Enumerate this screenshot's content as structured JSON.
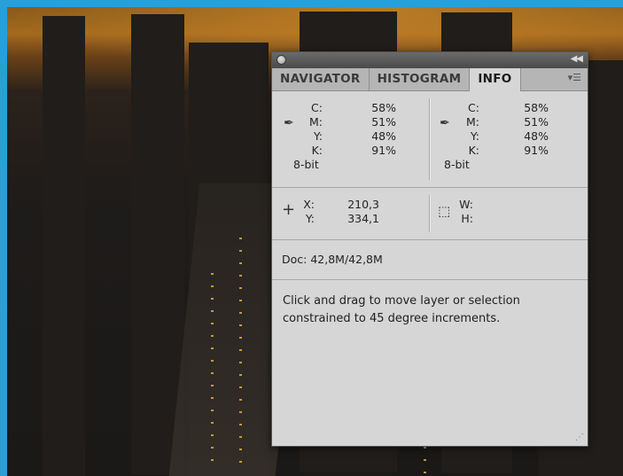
{
  "panel": {
    "tabs": [
      {
        "label": "NAVIGATOR"
      },
      {
        "label": "HISTOGRAM"
      },
      {
        "label": "INFO"
      }
    ],
    "left_color": {
      "labels": [
        "C:",
        "M:",
        "Y:",
        "K:"
      ],
      "values": [
        "58%",
        "51%",
        "48%",
        "91%"
      ],
      "bit": "8-bit"
    },
    "right_color": {
      "labels": [
        "C:",
        "M:",
        "Y:",
        "K:"
      ],
      "values": [
        "58%",
        "51%",
        "48%",
        "91%"
      ],
      "bit": "8-bit"
    },
    "position": {
      "x_label": "X:",
      "x_value": "210,3",
      "y_label": "Y:",
      "y_value": "334,1"
    },
    "size": {
      "w_label": "W:",
      "h_label": "H:"
    },
    "doc": "Doc: 42,8M/42,8M",
    "message": "Click and drag to move layer or selection constrained to 45 degree increments."
  },
  "icons": {
    "eyedropper": "eyedropper-icon",
    "crosshair": "crosshair-icon",
    "selection": "selection-icon",
    "menu": "panel-menu-icon",
    "collapse": "collapse-icon"
  }
}
